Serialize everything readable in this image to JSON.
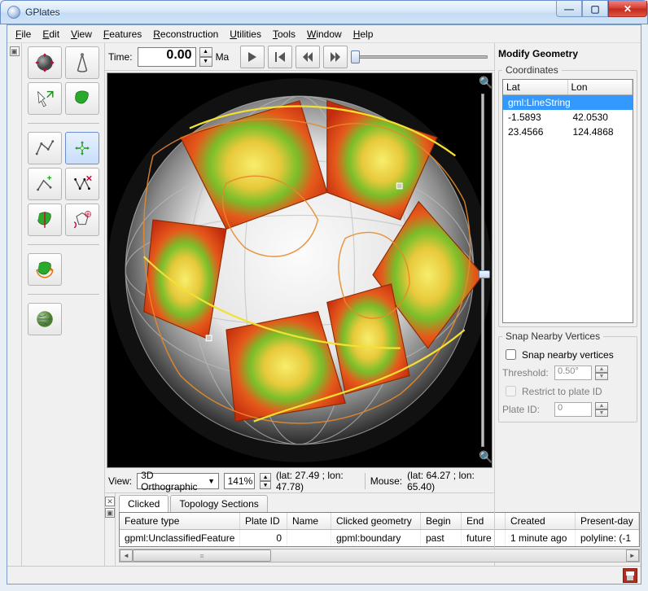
{
  "window": {
    "title": "GPlates"
  },
  "menu": {
    "items": [
      "File",
      "Edit",
      "View",
      "Features",
      "Reconstruction",
      "Utilities",
      "Tools",
      "Window",
      "Help"
    ]
  },
  "time": {
    "label": "Time:",
    "value": "0.00",
    "unit": "Ma"
  },
  "view_row": {
    "label": "View:",
    "projection": "3D Orthographic",
    "zoom": "141%",
    "center": "(lat: 27.49 ; lon: 47.78)",
    "mouse_label": "Mouse:",
    "mouse": "(lat: 64.27 ; lon: 65.40)"
  },
  "right": {
    "title": "Modify Geometry",
    "coords_legend": "Coordinates",
    "headers": {
      "lat": "Lat",
      "lon": "Lon"
    },
    "group_row": "gml:LineString",
    "rows": [
      {
        "lat": "-1.5893",
        "lon": "42.0530"
      },
      {
        "lat": "23.4566",
        "lon": "124.4868"
      }
    ],
    "snap_legend": "Snap Nearby Vertices",
    "snap_check": "Snap nearby vertices",
    "threshold_label": "Threshold:",
    "threshold_value": "0.50°",
    "restrict_label": "Restrict to plate ID",
    "plateid_label": "Plate ID:",
    "plateid_value": "0"
  },
  "tabs": {
    "clicked": "Clicked",
    "topo": "Topology Sections"
  },
  "table": {
    "headers": [
      "Feature type",
      "Plate ID",
      "Name",
      "Clicked geometry",
      "Begin",
      "End",
      "Created",
      "Present-day"
    ],
    "row": [
      "gpml:UnclassifiedFeature",
      "0",
      "",
      "gpml:boundary",
      "past",
      "future",
      "1 minute ago",
      "polyline: (-1"
    ]
  }
}
